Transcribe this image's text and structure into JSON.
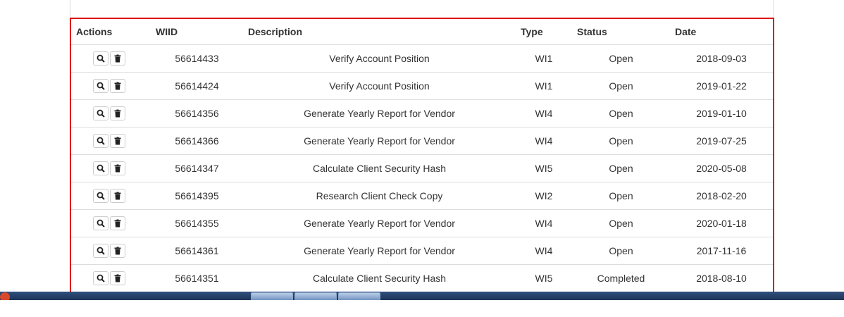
{
  "table": {
    "headers": {
      "actions": "Actions",
      "wiid": "WIID",
      "description": "Description",
      "type": "Type",
      "status": "Status",
      "date": "Date"
    },
    "rows": [
      {
        "wiid": "56614433",
        "description": "Verify Account Position",
        "type": "WI1",
        "status": "Open",
        "date": "2018-09-03"
      },
      {
        "wiid": "56614424",
        "description": "Verify Account Position",
        "type": "WI1",
        "status": "Open",
        "date": "2019-01-22"
      },
      {
        "wiid": "56614356",
        "description": "Generate Yearly Report for Vendor",
        "type": "WI4",
        "status": "Open",
        "date": "2019-01-10"
      },
      {
        "wiid": "56614366",
        "description": "Generate Yearly Report for Vendor",
        "type": "WI4",
        "status": "Open",
        "date": "2019-07-25"
      },
      {
        "wiid": "56614347",
        "description": "Calculate Client Security Hash",
        "type": "WI5",
        "status": "Open",
        "date": "2020-05-08"
      },
      {
        "wiid": "56614395",
        "description": "Research Client Check Copy",
        "type": "WI2",
        "status": "Open",
        "date": "2018-02-20"
      },
      {
        "wiid": "56614355",
        "description": "Generate Yearly Report for Vendor",
        "type": "WI4",
        "status": "Open",
        "date": "2020-01-18"
      },
      {
        "wiid": "56614361",
        "description": "Generate Yearly Report for Vendor",
        "type": "WI4",
        "status": "Open",
        "date": "2017-11-16"
      },
      {
        "wiid": "56614351",
        "description": "Calculate Client Security Hash",
        "type": "WI5",
        "status": "Completed",
        "date": "2018-08-10"
      }
    ],
    "row_actions": {
      "view_icon": "search-icon",
      "delete_icon": "trash-icon"
    }
  },
  "colors": {
    "highlight_border": "#dd0000",
    "row_divider": "#dddddd",
    "text": "#333333"
  }
}
